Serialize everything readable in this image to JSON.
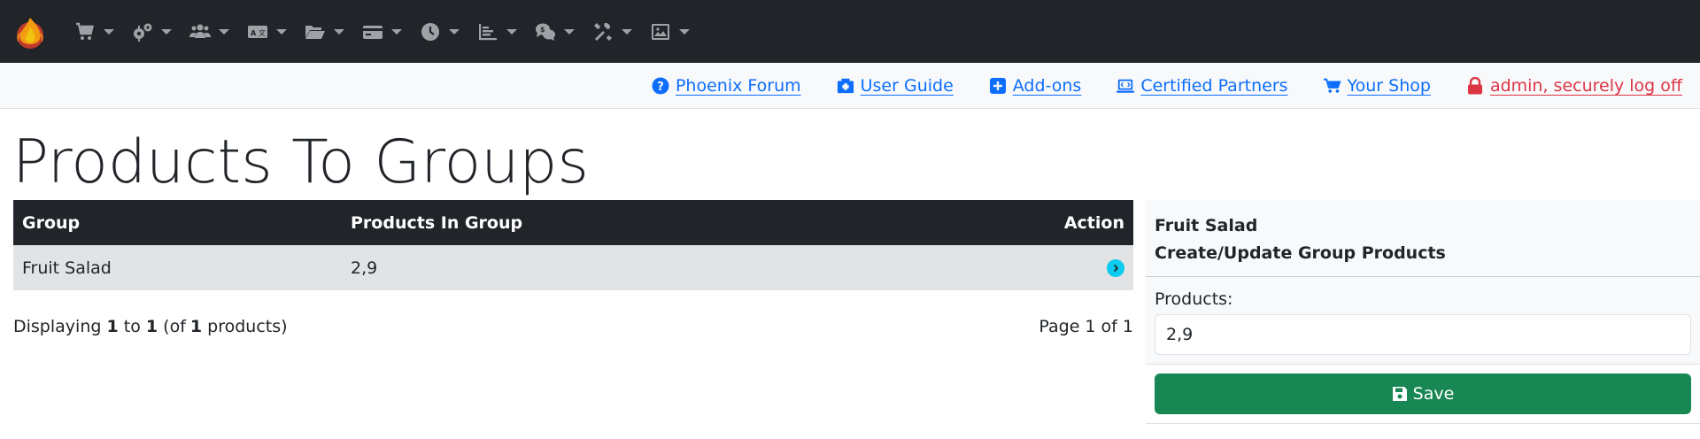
{
  "navbar": {
    "logo": "phoenix-flame-logo",
    "menus": [
      {
        "icon": "cart-icon"
      },
      {
        "icon": "gears-icon"
      },
      {
        "icon": "users-icon"
      },
      {
        "icon": "language-icon"
      },
      {
        "icon": "folder-open-icon"
      },
      {
        "icon": "credit-card-icon"
      },
      {
        "icon": "clock-icon"
      },
      {
        "icon": "chart-bar-icon"
      },
      {
        "icon": "comments-dollar-icon"
      },
      {
        "icon": "tools-icon"
      },
      {
        "icon": "image-icon"
      }
    ]
  },
  "subbar": {
    "links": [
      {
        "label": "Phoenix Forum",
        "icon": "question-circle-icon"
      },
      {
        "label": "User Guide",
        "icon": "hospital-user-icon"
      },
      {
        "label": "Add-ons",
        "icon": "plus-square-icon"
      },
      {
        "label": "Certified Partners",
        "icon": "laptop-code-icon"
      },
      {
        "label": "Your Shop",
        "icon": "shopping-cart-icon"
      },
      {
        "label": "admin, securely log off",
        "icon": "lock-icon"
      }
    ],
    "logoff_color": "#dc3545",
    "link_color": "#0d6efd"
  },
  "page": {
    "title": "Products To Groups"
  },
  "table": {
    "headers": {
      "group": "Group",
      "products": "Products In Group",
      "action": "Action"
    },
    "rows": [
      {
        "group": "Fruit Salad",
        "products": "2,9",
        "action_icon": "chevron-right-circle-icon"
      }
    ]
  },
  "pager": {
    "prefix": "Displaying",
    "from": "1",
    "to_word": "to",
    "to": "1",
    "of_open": "(of",
    "total": "1",
    "of_close": "products)",
    "page_text": "Page 1 of 1"
  },
  "side": {
    "title": "Fruit Salad",
    "subtitle": "Create/Update Group Products",
    "field_label": "Products:",
    "field_value": "2,9",
    "save_label": "Save",
    "save_color": "#198754"
  }
}
